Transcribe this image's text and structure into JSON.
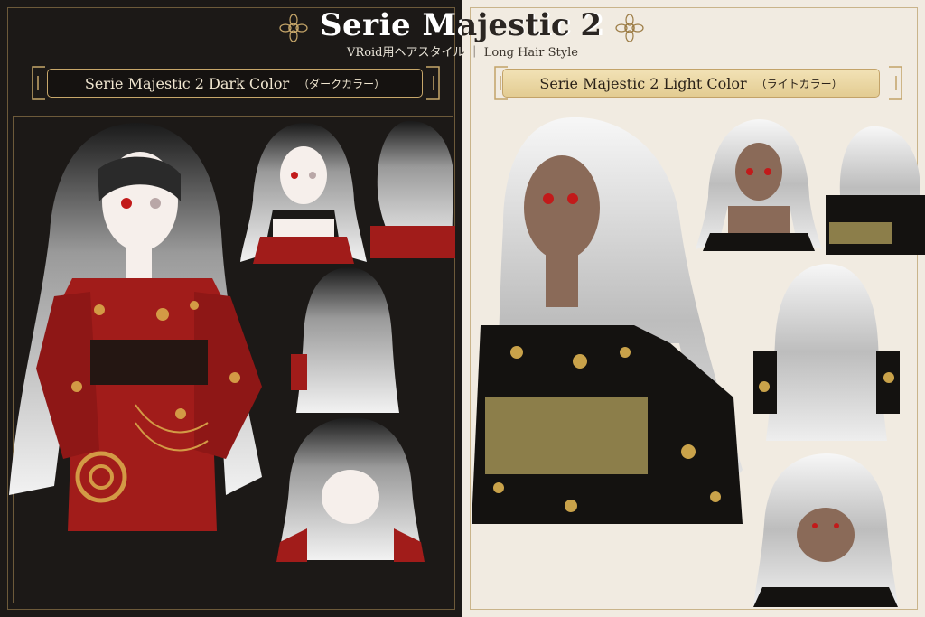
{
  "header": {
    "title": "Serie Majestic 2",
    "subtitle": "VRoid用ヘアスタイル ｜ Long Hair Style"
  },
  "dark_panel": {
    "label": "Serie Majestic 2 Dark Color",
    "label_jp": "（ダークカラー）",
    "background": "#1c1917",
    "kimono_color": "#a11c1a",
    "accent": "#c7a76a"
  },
  "light_panel": {
    "label": "Serie Majestic 2 Light Color",
    "label_jp": "（ライトカラー）",
    "background": "#f1ebe1",
    "kimono_color": "#141210",
    "accent": "#c3a369"
  }
}
